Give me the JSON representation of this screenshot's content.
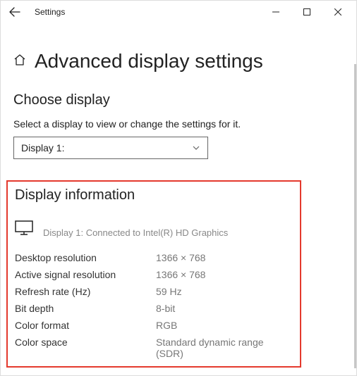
{
  "titlebar": {
    "label": "Settings"
  },
  "page": {
    "title": "Advanced display settings"
  },
  "choose_display": {
    "heading": "Choose display",
    "instruction": "Select a display to view or change the settings for it.",
    "selected": "Display 1:"
  },
  "display_info": {
    "heading": "Display information",
    "connected_text": "Display 1: Connected to Intel(R) HD Graphics",
    "rows": [
      {
        "label": "Desktop resolution",
        "value": "1366 × 768"
      },
      {
        "label": "Active signal resolution",
        "value": "1366 × 768"
      },
      {
        "label": "Refresh rate (Hz)",
        "value": "59 Hz"
      },
      {
        "label": "Bit depth",
        "value": "8-bit"
      },
      {
        "label": "Color format",
        "value": "RGB"
      },
      {
        "label": "Color space",
        "value": "Standard dynamic range (SDR)"
      }
    ]
  }
}
